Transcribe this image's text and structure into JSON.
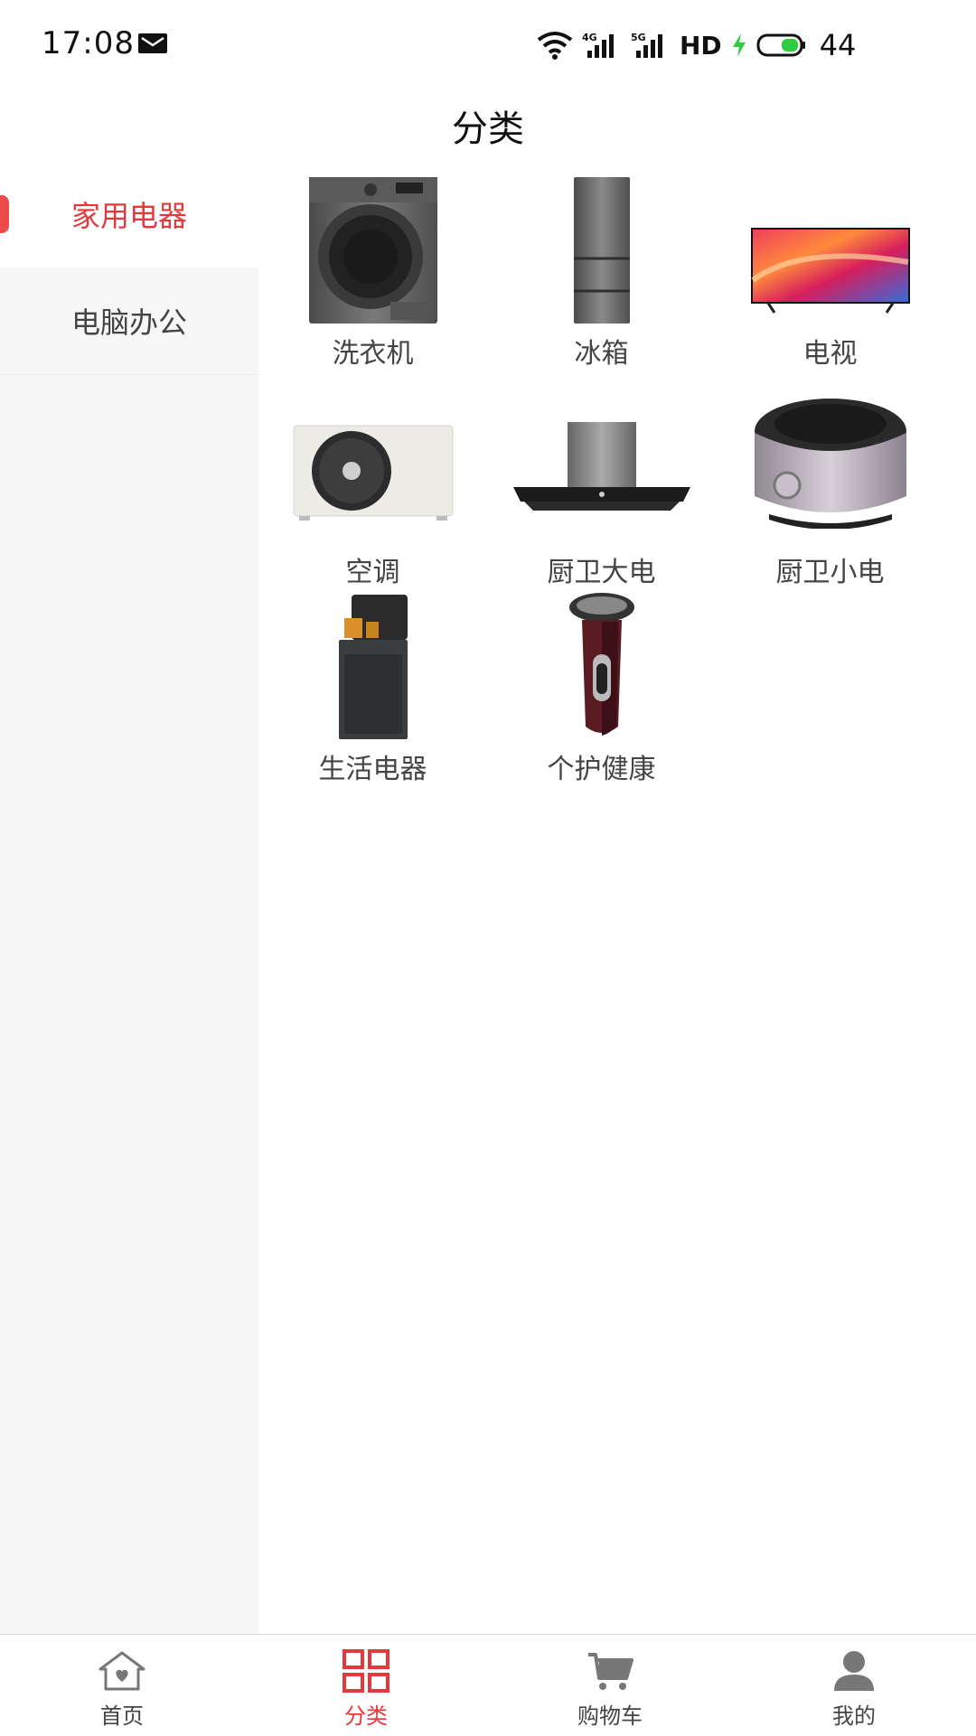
{
  "status_bar": {
    "time": "17:08",
    "hd": "HD",
    "battery": "44"
  },
  "header": {
    "title": "分类"
  },
  "sidebar": {
    "items": [
      {
        "label": "家用电器",
        "active": true
      },
      {
        "label": "电脑办公",
        "active": false
      }
    ]
  },
  "categories": [
    {
      "label": "洗衣机",
      "icon": "washing-machine-icon"
    },
    {
      "label": "冰箱",
      "icon": "refrigerator-icon"
    },
    {
      "label": "电视",
      "icon": "tv-icon"
    },
    {
      "label": "空调",
      "icon": "air-conditioner-icon"
    },
    {
      "label": "厨卫大电",
      "icon": "range-hood-icon"
    },
    {
      "label": "厨卫小电",
      "icon": "rice-cooker-icon"
    },
    {
      "label": "生活电器",
      "icon": "water-dispenser-icon"
    },
    {
      "label": "个护健康",
      "icon": "shaver-icon"
    }
  ],
  "tab_bar": {
    "tabs": [
      {
        "label": "首页",
        "icon": "home-icon",
        "active": false
      },
      {
        "label": "分类",
        "icon": "category-grid-icon",
        "active": true
      },
      {
        "label": "购物车",
        "icon": "cart-icon",
        "active": false
      },
      {
        "label": "我的",
        "icon": "user-icon",
        "active": false
      }
    ]
  },
  "colors": {
    "accent": "#e4393c",
    "sidebar_bg": "#f7f7f7",
    "text": "#444444"
  }
}
